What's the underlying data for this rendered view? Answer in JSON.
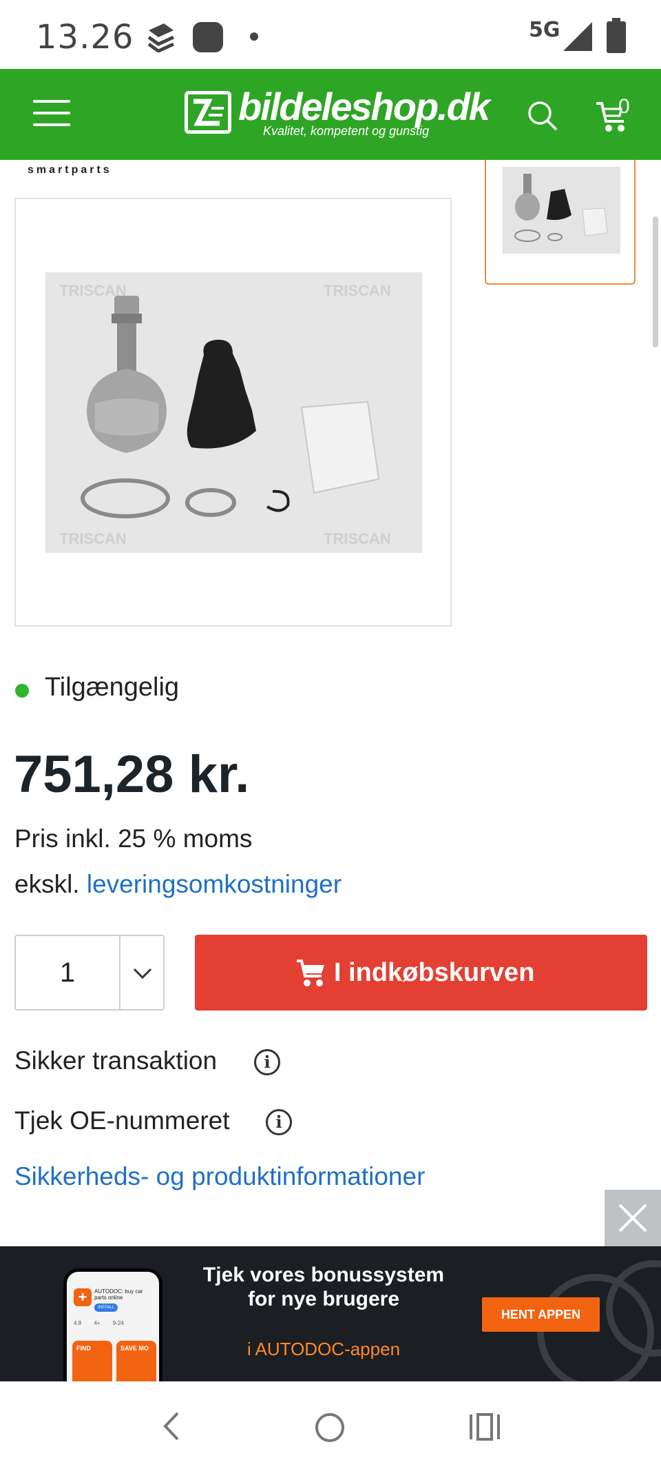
{
  "status_bar": {
    "time": "13.26",
    "network": "5G"
  },
  "header": {
    "logo_name": "bildeleshop.dk",
    "logo_tagline": "Kvalitet, kompetent og gunstig",
    "cart_count": "0",
    "accent_color": "#2fa526"
  },
  "product": {
    "brand_text": "smartparts",
    "image_watermark": "TRISCAN",
    "availability": "Tilgængelig",
    "price": "751,28 kr.",
    "vat_note": "Pris inkl. 25 % moms",
    "shipping_prefix": "ekskl.",
    "shipping_link": "leveringsomkostninger",
    "quantity": "1",
    "add_to_cart_label": "I indkøbskurven",
    "add_to_cart_color": "#e43f33",
    "secure_transaction": "Sikker transaktion",
    "check_oe": "Tjek OE-nummeret",
    "safety_link": "Sikkerheds- og produktinformationer"
  },
  "ad": {
    "title": "Tjek vores bonussystem for nye brugere",
    "subtitle": "i AUTODOC-appen",
    "button": "HENT APPEN",
    "phone_heading": "AUTODOC: buy car parts online",
    "phone_button": "INSTALL",
    "phone_stats": [
      "4.8",
      "4+",
      "9-24"
    ],
    "phone_tiles": [
      "FIND",
      "SAVE MO"
    ]
  }
}
